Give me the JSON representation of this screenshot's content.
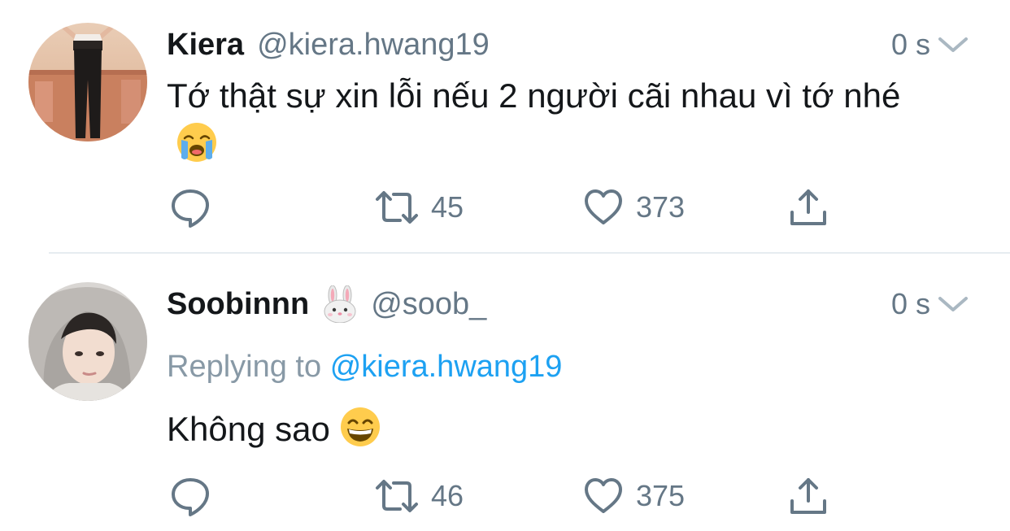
{
  "colors": {
    "text": "#14171a",
    "secondary": "#657786",
    "link": "#1da1f2",
    "divider": "#e6ecf0"
  },
  "tweets": [
    {
      "display_name": "Kiera",
      "handle": "@kiera.hwang19",
      "time": "0 s",
      "body": "Tớ thật sự xin lỗi nếu 2 người cãi nhau vì tớ nhé",
      "body_emoji": "loudly-crying-face",
      "replies": "",
      "retweets": "45",
      "likes": "373"
    },
    {
      "display_name": "Soobinnn",
      "name_emoji": "rabbit-face",
      "handle": "@soob_",
      "time": "0 s",
      "replying_label": "Replying to",
      "replying_handle": "@kiera.hwang19",
      "body": "Không sao",
      "body_emoji": "grinning-face",
      "replies": "",
      "retweets": "46",
      "likes": "375"
    }
  ],
  "icons": {
    "reply": "reply-icon",
    "retweet": "retweet-icon",
    "like": "heart-icon",
    "share": "share-icon",
    "caret": "chevron-down-icon"
  }
}
